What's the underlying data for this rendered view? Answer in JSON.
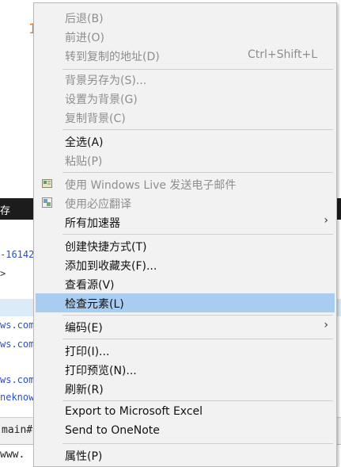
{
  "background": {
    "orange_glyph": "1",
    "dark_bar_text": "存",
    "code_lines": [
      "-16142",
      ">",
      "ws.com",
      "ws.com",
      "ws.com",
      "neknow"
    ],
    "status_text": "main#",
    "bottom_text": "www."
  },
  "menu": {
    "back": "后退(B)",
    "forward": "前进(O)",
    "goto_copied": "转到复制的地址(D)",
    "goto_shortcut": "Ctrl+Shift+L",
    "save_bg": "背景另存为(S)...",
    "set_bg": "设置为背景(G)",
    "copy_bg": "复制背景(C)",
    "select_all": "全选(A)",
    "paste": "粘贴(P)",
    "email_live": "使用 Windows Live 发送电子邮件",
    "bing_translate": "使用必应翻译",
    "all_accelerators": "所有加速器",
    "create_shortcut": "创建快捷方式(T)",
    "add_favorites": "添加到收藏夹(F)...",
    "view_source": "查看源(V)",
    "inspect": "检查元素(L)",
    "encoding": "编码(E)",
    "print": "打印(I)...",
    "print_preview": "打印预览(N)...",
    "refresh": "刷新(R)",
    "export_excel": "Export to Microsoft Excel",
    "send_onenote": "Send to OneNote",
    "properties": "属性(P)"
  },
  "colors": {
    "menu_bg": "#f2f2f2",
    "hover": "#a9cdf0",
    "disabled_text": "#8e8e8e"
  }
}
